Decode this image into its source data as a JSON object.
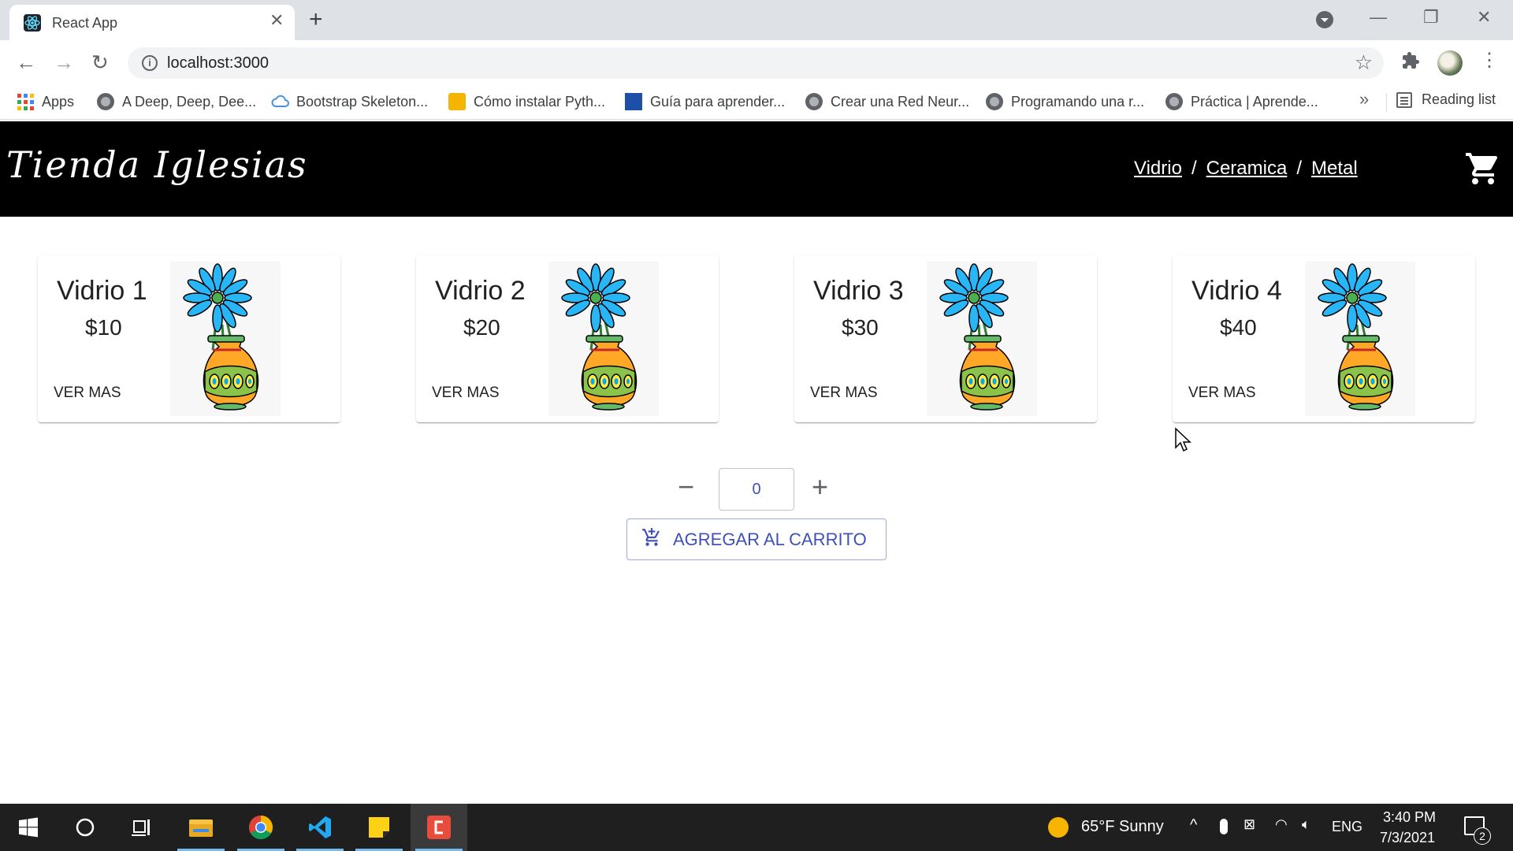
{
  "browser": {
    "tab_title": "React App",
    "url": "localhost:3000",
    "bookmarks": [
      {
        "label": "Apps",
        "icon": "apps-icon"
      },
      {
        "label": "A Deep, Deep, Dee...",
        "icon": "globe-icon"
      },
      {
        "label": "Bootstrap Skeleton...",
        "icon": "cloud-icon"
      },
      {
        "label": "Cómo instalar Pyth...",
        "icon": "site-icon"
      },
      {
        "label": "Guía para aprender...",
        "icon": "site-icon"
      },
      {
        "label": "Crear una Red Neur...",
        "icon": "globe-icon"
      },
      {
        "label": "Programando una r...",
        "icon": "globe-icon"
      },
      {
        "label": "Práctica | Aprende...",
        "icon": "globe-icon"
      }
    ],
    "more_bookmarks": "»",
    "reading_list": "Reading list"
  },
  "app": {
    "brand": "Tienda Iglesias",
    "nav": {
      "vidrio": "Vidrio",
      "ceramica": "Ceramica",
      "metal": "Metal",
      "separator": "/"
    },
    "products": [
      {
        "name": "Vidrio 1",
        "price": "$10",
        "button": "VER MAS"
      },
      {
        "name": "Vidrio 2",
        "price": "$20",
        "button": "VER MAS"
      },
      {
        "name": "Vidrio 3",
        "price": "$30",
        "button": "VER MAS"
      },
      {
        "name": "Vidrio 4",
        "price": "$40",
        "button": "VER MAS"
      }
    ],
    "quantity": "0",
    "add_to_cart": "AGREGAR AL CARRITO"
  },
  "taskbar": {
    "weather": "65°F  Sunny",
    "language": "ENG",
    "time": "3:40 PM",
    "date": "7/3/2021",
    "notifications": "2"
  },
  "colors": {
    "accent": "#3f51b5",
    "header_bg": "#000000"
  }
}
